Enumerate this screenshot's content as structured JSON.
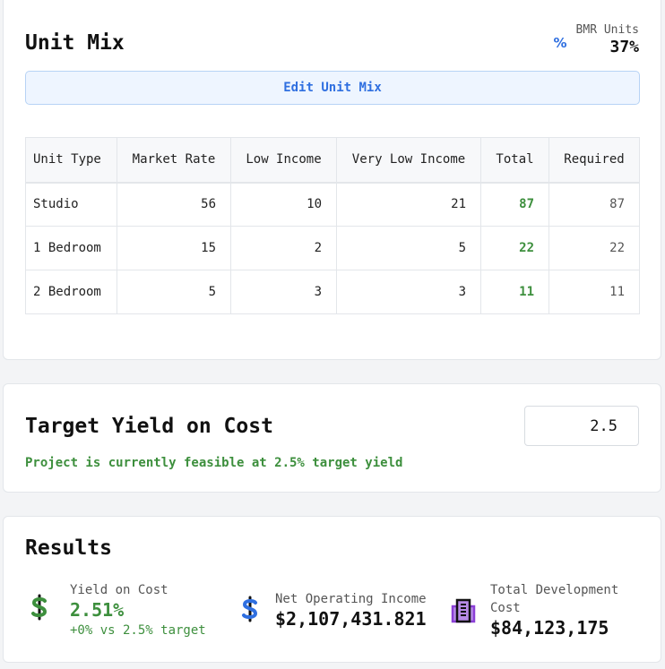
{
  "unit_mix": {
    "title": "Unit Mix",
    "bmr_label": "BMR Units",
    "bmr_value": "37%",
    "bmr_icon": "%",
    "edit_button": "Edit Unit Mix",
    "columns": [
      "Unit Type",
      "Market Rate",
      "Low Income",
      "Very Low Income",
      "Total",
      "Required"
    ],
    "rows": [
      {
        "unit_type": "Studio",
        "market_rate": "56",
        "low_income": "10",
        "very_low_income": "21",
        "total": "87",
        "required": "87"
      },
      {
        "unit_type": "1 Bedroom",
        "market_rate": "15",
        "low_income": "2",
        "very_low_income": "5",
        "total": "22",
        "required": "22"
      },
      {
        "unit_type": "2 Bedroom",
        "market_rate": "5",
        "low_income": "3",
        "very_low_income": "3",
        "total": "11",
        "required": "11"
      }
    ]
  },
  "target_yield": {
    "title": "Target Yield on Cost",
    "value": "2.5",
    "status": "Project is currently feasible at 2.5% target yield"
  },
  "results": {
    "title": "Results",
    "yield_on_cost": {
      "label": "Yield on Cost",
      "value": "2.51%",
      "sub": "+0% vs 2.5% target",
      "icon": "dollar-icon"
    },
    "noi": {
      "label": "Net Operating Income",
      "value": "$2,107,431.821",
      "icon": "dollar-icon"
    },
    "tdc": {
      "label": "Total Development Cost",
      "value": "$84,123,175",
      "icon": "building-icon"
    }
  },
  "colors": {
    "accent": "#2f6fe0",
    "success": "#3d8f3d",
    "purple": "#8b3fd6"
  }
}
